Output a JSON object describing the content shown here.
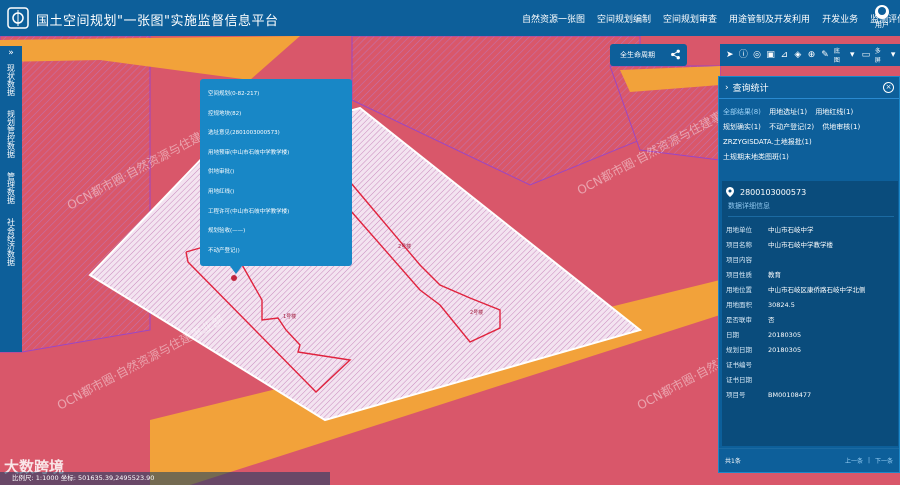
{
  "header": {
    "title": "国土空间规划\"一张图\"实施监督信息平台",
    "nav": [
      "自然资源一张图",
      "空间规划编制",
      "空间规划审查",
      "用途管制及开发利用",
      "开发业务",
      "监测评估预警"
    ],
    "user_label": "用户"
  },
  "sidebar": {
    "groups": [
      {
        "label": "现状数据"
      },
      {
        "label": "规划管控数据"
      },
      {
        "label": "管理数据"
      },
      {
        "label": "社会经济数据"
      }
    ]
  },
  "search": {
    "label": "全生命周期"
  },
  "toolbar": {
    "basemap_label": "底图",
    "multi_label": "多屏"
  },
  "popup": {
    "rows": [
      "空间规划(0-82-217)",
      "控规地块(82)",
      "选址意见(2801003000573)",
      "用地预审(中山市石岐中学教学楼)",
      "供地审批()",
      "用地红线()",
      "工程许可(中山市石岐中学教学楼)",
      "规划验收(——)",
      "不动产登记()"
    ]
  },
  "map": {
    "labels": {
      "b1": "1号楼",
      "b2": "2号楼",
      "b3": "2号楼"
    },
    "watermarks": [
      "OCN都市圈·自然资源与住建事业部",
      "OCN都市圈·自然资源与住建事业部",
      "OCN都市圈·自然资源与住建事业部",
      "OCN都市圈·自然资源与住建事业部"
    ]
  },
  "panel": {
    "title": "查询统计",
    "categories": [
      {
        "label": "全部结果(8)",
        "selected": true
      },
      {
        "label": "用地选址(1)",
        "selected": false
      },
      {
        "label": "用地红线(1)",
        "selected": false
      },
      {
        "label": "规划确实(1)",
        "selected": false
      },
      {
        "label": "不动产登记(2)",
        "selected": false
      },
      {
        "label": "供地审核(1)",
        "selected": false
      },
      {
        "label": "ZRZYGISDATA.土地报批(1)",
        "selected": false
      },
      {
        "label": "土规期末地类图斑(1)",
        "selected": false
      }
    ],
    "parcel_id": "2800103000573",
    "more_label": "数据详细信息",
    "fields": [
      {
        "k": "用地单位",
        "v": "中山市石岐中学"
      },
      {
        "k": "项目名称",
        "v": "中山市石岐中学教学楼"
      },
      {
        "k": "项目内容",
        "v": ""
      },
      {
        "k": "项目性质",
        "v": "教育"
      },
      {
        "k": "用地位置",
        "v": "中山市石岐区康侨路石岐中学北侧"
      },
      {
        "k": "用地面积",
        "v": "30824.5"
      },
      {
        "k": "是否联审",
        "v": "否"
      },
      {
        "k": "日期",
        "v": "20180305"
      },
      {
        "k": "规划日期",
        "v": "20180305"
      },
      {
        "k": "证书编号",
        "v": ""
      },
      {
        "k": "证书日期",
        "v": ""
      },
      {
        "k": "项目号",
        "v": "BM00108477"
      }
    ],
    "footer_count": "共1条",
    "prev_label": "上一条",
    "next_label": "下一条"
  },
  "status": {
    "text": "比例尺: 1:1000    坐标: 501635.39,2495523.90"
  },
  "brand": {
    "text": "大数跨境"
  },
  "colors": {
    "primary": "#0d5f9a",
    "accent": "#1887c6",
    "map_pink": "#d9576a",
    "road_orange": "#f2a23a",
    "parcel_outline": "#e0233e"
  }
}
